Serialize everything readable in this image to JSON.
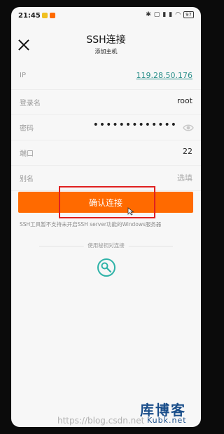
{
  "status_bar": {
    "time": "21:45",
    "battery": "97"
  },
  "header": {
    "title": "SSH连接",
    "subtitle": "添加主机"
  },
  "form": {
    "ip": {
      "label": "IP",
      "value": "119.28.50.176"
    },
    "username": {
      "label": "登录名",
      "value": "root"
    },
    "password": {
      "label": "密码",
      "mask": "•••••••••••••"
    },
    "port": {
      "label": "端口",
      "value": "22"
    },
    "alias": {
      "label": "别名",
      "placeholder": "选填"
    }
  },
  "confirm_label": "确认连接",
  "note": "SSH工具暂不支持未开启SSH server功能的Windows服务器",
  "key_divider": "使用秘钥对连接",
  "watermark": {
    "url": "https://blog.csdn.net",
    "brand": "库博客",
    "brand_sub": "Kubk.net"
  },
  "colors": {
    "accent": "#ff6a00",
    "link": "#2a8f8a",
    "teal": "#2fb3a8",
    "highlight": "#e02020"
  },
  "icons": {
    "close": "close-icon",
    "eye": "eye-icon",
    "key": "key-icon"
  }
}
